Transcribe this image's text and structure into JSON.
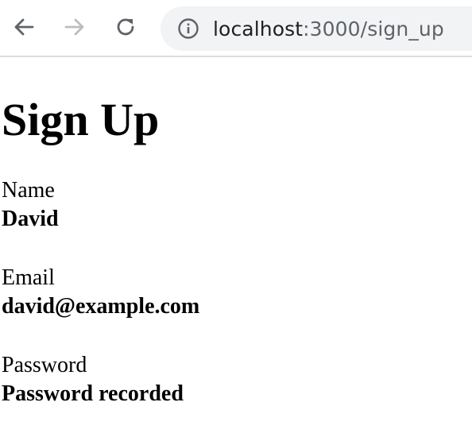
{
  "browser": {
    "url_host": "localhost",
    "url_path": ":3000/sign_up",
    "icons": {
      "back": "back-arrow-icon",
      "forward": "forward-arrow-icon",
      "reload": "reload-icon",
      "info": "info-icon"
    }
  },
  "page": {
    "title": "Sign Up",
    "fields": [
      {
        "label": "Name",
        "value": "David"
      },
      {
        "label": "Email",
        "value": "david@example.com"
      },
      {
        "label": "Password",
        "value": "Password recorded"
      }
    ]
  }
}
